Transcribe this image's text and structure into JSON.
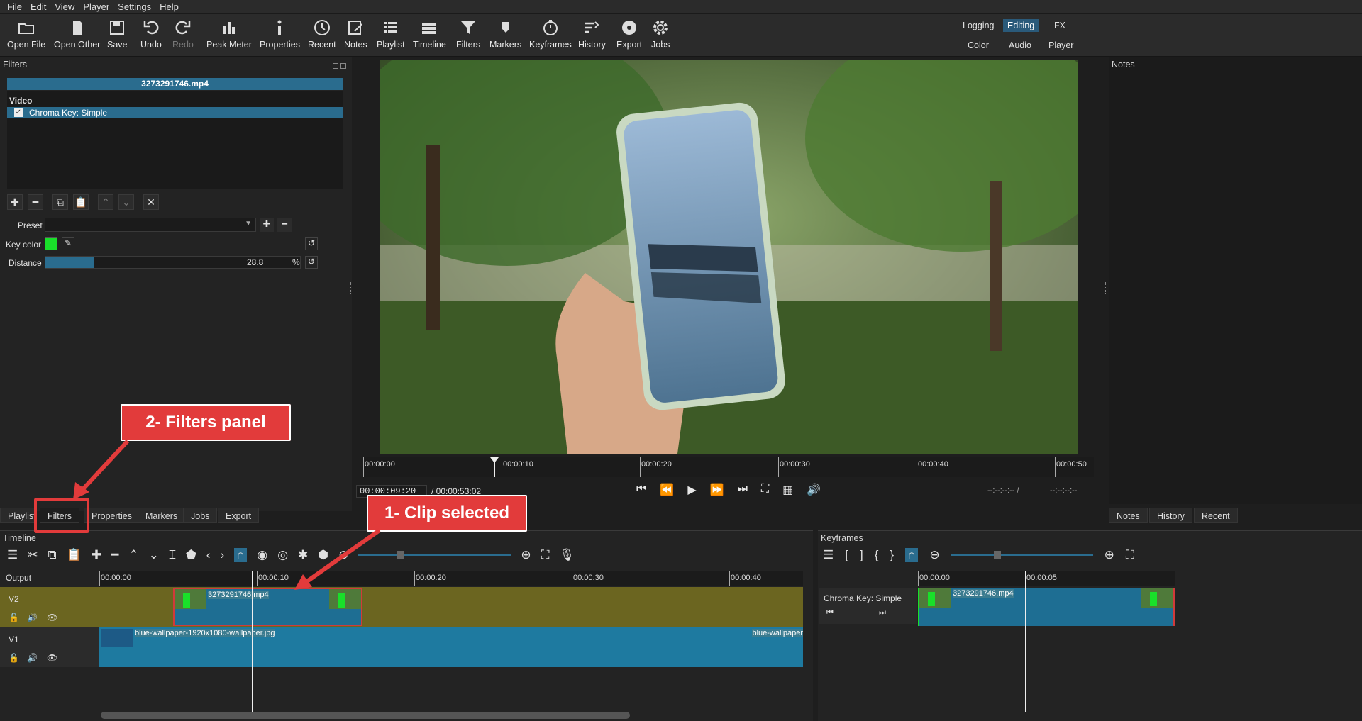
{
  "menu": [
    "File",
    "Edit",
    "View",
    "Player",
    "Settings",
    "Help"
  ],
  "toolbar": {
    "open_file": "Open File",
    "open_other": "Open Other",
    "save": "Save",
    "undo": "Undo",
    "redo": "Redo",
    "peak_meter": "Peak Meter",
    "properties": "Properties",
    "recent": "Recent",
    "notes": "Notes",
    "playlist": "Playlist",
    "timeline": "Timeline",
    "filters": "Filters",
    "markers": "Markers",
    "keyframes": "Keyframes",
    "history": "History",
    "export": "Export",
    "jobs": "Jobs"
  },
  "layouts": {
    "logging": "Logging",
    "editing": "Editing",
    "fx": "FX",
    "color": "Color",
    "audio": "Audio",
    "player": "Player"
  },
  "filters": {
    "title": "Filters",
    "clip_name": "3273291746.mp4",
    "section": "Video",
    "item": "Chroma Key: Simple",
    "item_checked": true,
    "preset_label": "Preset",
    "key_color_label": "Key color",
    "key_color": "#19e02a",
    "distance_label": "Distance",
    "distance_value": "28.8",
    "distance_unit": "%",
    "distance_fraction": 0.19
  },
  "notes": {
    "title": "Notes"
  },
  "player": {
    "ruler": [
      "00:00:00",
      "00:00:10",
      "00:00:20",
      "00:00:30",
      "00:00:40",
      "00:00:50"
    ],
    "timecode": "00:00:09:20",
    "duration": "/ 00:00:53:02",
    "in_out_a": "--:--:--:-- /",
    "in_out_b": "--:--:--:--"
  },
  "left_tabs": [
    "Playlist",
    "Filters",
    "Properties",
    "Markers",
    "Jobs",
    "Export"
  ],
  "right_tabs": [
    "Notes",
    "History",
    "Recent"
  ],
  "timeline": {
    "title": "Timeline",
    "output": "Output",
    "ruler": [
      "00:00:00",
      "00:00:10",
      "00:00:20",
      "00:00:30",
      "00:00:40"
    ],
    "v2": "V2",
    "v1": "V1",
    "clip_v2": "3273291746.mp4",
    "clip_v1": "blue-wallpaper-1920x1080-wallpaper.jpg",
    "clip_v1_end": "blue-wallpaper"
  },
  "keyframes": {
    "title": "Keyframes",
    "ruler": [
      "00:00:00",
      "00:00:05"
    ],
    "filter": "Chroma Key: Simple",
    "clip": "3273291746.mp4"
  },
  "annotations": {
    "a1": "2- Filters panel",
    "a2": "1- Clip selected"
  },
  "colors": {
    "accent": "#2a6c8e",
    "track_v2": "#6b6520",
    "clip": "#1e7aa0",
    "annotation": "#e23b3b"
  }
}
